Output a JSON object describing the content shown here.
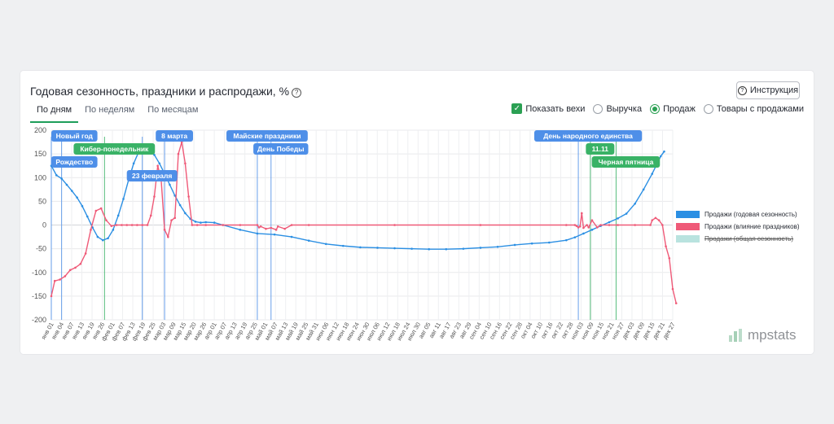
{
  "header": {
    "title": "Годовая сезонность, праздники и распродажи, %",
    "help_icon": "question-circle-icon",
    "instruction_button": "Инструкция"
  },
  "tabs": [
    {
      "label": "По дням",
      "active": true
    },
    {
      "label": "По неделям",
      "active": false
    },
    {
      "label": "По месяцам",
      "active": false
    }
  ],
  "controls": {
    "show_milestones": "Показать вехи",
    "options": [
      {
        "label": "Выручка",
        "selected": false
      },
      {
        "label": "Продаж",
        "selected": true
      },
      {
        "label": "Товары с продажами",
        "selected": false
      }
    ]
  },
  "legend": [
    {
      "label": "Продажи (годовая сезонность)",
      "color": "#2b8fe3",
      "hidden": false
    },
    {
      "label": "Продажи (влияние праздников)",
      "color": "#ef5a78",
      "hidden": false
    },
    {
      "label": "Продажи (общая сезонность)",
      "color": "#b9e3df",
      "hidden": true
    }
  ],
  "logo": "mpstats",
  "chart_data": {
    "type": "line",
    "ylim": [
      -200,
      200
    ],
    "yticks": [
      200,
      150,
      100,
      50,
      0,
      -50,
      -100,
      -150,
      -200
    ],
    "x_tick_labels": [
      "янв 01",
      "янв 04",
      "янв 07",
      "янв 13",
      "янв 19",
      "янв 26",
      "фев 01",
      "фев 07",
      "фев 13",
      "фев 19",
      "фев 25",
      "мар 03",
      "мар 09",
      "мар 15",
      "мар 20",
      "мар 26",
      "апр 01",
      "апр 07",
      "апр 13",
      "апр 19",
      "апр 25",
      "май 01",
      "май 07",
      "май 13",
      "май 19",
      "май 25",
      "май 31",
      "июн 06",
      "июн 12",
      "июн 18",
      "июн 24",
      "июн 30",
      "июл 06",
      "июл 12",
      "июл 18",
      "июл 24",
      "июл 30",
      "авг 05",
      "авг 11",
      "авг 17",
      "авг 23",
      "авг 29",
      "сен 04",
      "сен 10",
      "сен 16",
      "сен 22",
      "сен 28",
      "окт 04",
      "окт 10",
      "окт 16",
      "окт 22",
      "окт 28",
      "ноя 03",
      "ноя 09",
      "ноя 15",
      "ноя 21",
      "ноя 27",
      "дек 03",
      "дек 09",
      "дек 15",
      "дек 21",
      "дек 27"
    ],
    "milestones": [
      {
        "label": "Новый год",
        "x": "янв 01",
        "color": "#4e8fe8"
      },
      {
        "label": "Рождество",
        "x": "янв 07",
        "color": "#4e8fe8"
      },
      {
        "label": "Кибер-понедельник",
        "x": "фев 01",
        "color": "#39b266"
      },
      {
        "label": "23 февраля",
        "x": "фев 23",
        "color": "#4e8fe8"
      },
      {
        "label": "8 марта",
        "x": "мар 08",
        "color": "#4e8fe8"
      },
      {
        "label": "Майские праздники",
        "x": "май 01",
        "color": "#4e8fe8"
      },
      {
        "label": "День Победы",
        "x": "май 09",
        "color": "#4e8fe8"
      },
      {
        "label": "День народного единства",
        "x": "ноя 04",
        "color": "#4e8fe8"
      },
      {
        "label": "11.11",
        "x": "ноя 11",
        "color": "#39b266"
      },
      {
        "label": "Черная пятница",
        "x": "ноя 26",
        "color": "#39b266"
      }
    ],
    "series": [
      {
        "name": "Продажи (годовая сезонность)",
        "color": "#2b8fe3",
        "x": [
          0,
          3,
          6,
          9,
          12,
          15,
          18,
          21,
          24,
          27,
          30,
          33,
          36,
          39,
          42,
          45,
          48,
          51,
          54,
          57,
          60,
          63,
          66,
          69,
          72,
          75,
          78,
          81,
          84,
          87,
          90,
          95,
          100,
          110,
          120,
          130,
          140,
          150,
          160,
          170,
          180,
          190,
          200,
          210,
          220,
          230,
          240,
          250,
          260,
          270,
          280,
          290,
          300,
          305,
          310,
          315,
          320,
          325,
          330,
          335,
          340,
          345,
          350,
          355,
          357
        ],
        "y": [
          125,
          105,
          98,
          85,
          72,
          58,
          40,
          18,
          -5,
          -25,
          -32,
          -28,
          -10,
          20,
          55,
          95,
          130,
          155,
          163,
          160,
          148,
          130,
          108,
          85,
          62,
          42,
          25,
          13,
          7,
          5,
          6,
          5,
          0,
          -10,
          -18,
          -20,
          -25,
          -33,
          -40,
          -44,
          -47,
          -48,
          -49,
          -50,
          -51,
          -51,
          -50,
          -48,
          -46,
          -42,
          -39,
          -37,
          -32,
          -26,
          -18,
          -10,
          -2,
          6,
          14,
          24,
          45,
          75,
          108,
          145,
          155
        ]
      },
      {
        "name": "Продажи (влияние праздников)",
        "color": "#ef5a78",
        "x": [
          0,
          2,
          5,
          8,
          11,
          14,
          17,
          20,
          23,
          26,
          29,
          32,
          35,
          38,
          41,
          44,
          47,
          50,
          53,
          56,
          58,
          60,
          62,
          64,
          66,
          68,
          70,
          72,
          74,
          76,
          78,
          80,
          82,
          85,
          90,
          100,
          110,
          120,
          121,
          122,
          125,
          128,
          131,
          132,
          136,
          140,
          150,
          200,
          250,
          300,
          305,
          306,
          307,
          308,
          309,
          310,
          312,
          313,
          315,
          318,
          320,
          325,
          330,
          340,
          349,
          350,
          352,
          354,
          356,
          358,
          360,
          362,
          364
        ],
        "y": [
          -150,
          -118,
          -115,
          -108,
          -95,
          -90,
          -82,
          -60,
          -10,
          30,
          35,
          10,
          -2,
          0,
          0,
          0,
          0,
          0,
          0,
          0,
          20,
          60,
          125,
          95,
          -10,
          -25,
          10,
          15,
          150,
          175,
          130,
          60,
          0,
          0,
          0,
          0,
          0,
          0,
          -5,
          -3,
          -8,
          -6,
          -10,
          -3,
          -8,
          0,
          0,
          0,
          0,
          0,
          0,
          -2,
          -5,
          -3,
          25,
          -6,
          0,
          -5,
          10,
          -5,
          0,
          0,
          0,
          0,
          0,
          10,
          15,
          10,
          0,
          -45,
          -70,
          -135,
          -165
        ]
      }
    ]
  }
}
